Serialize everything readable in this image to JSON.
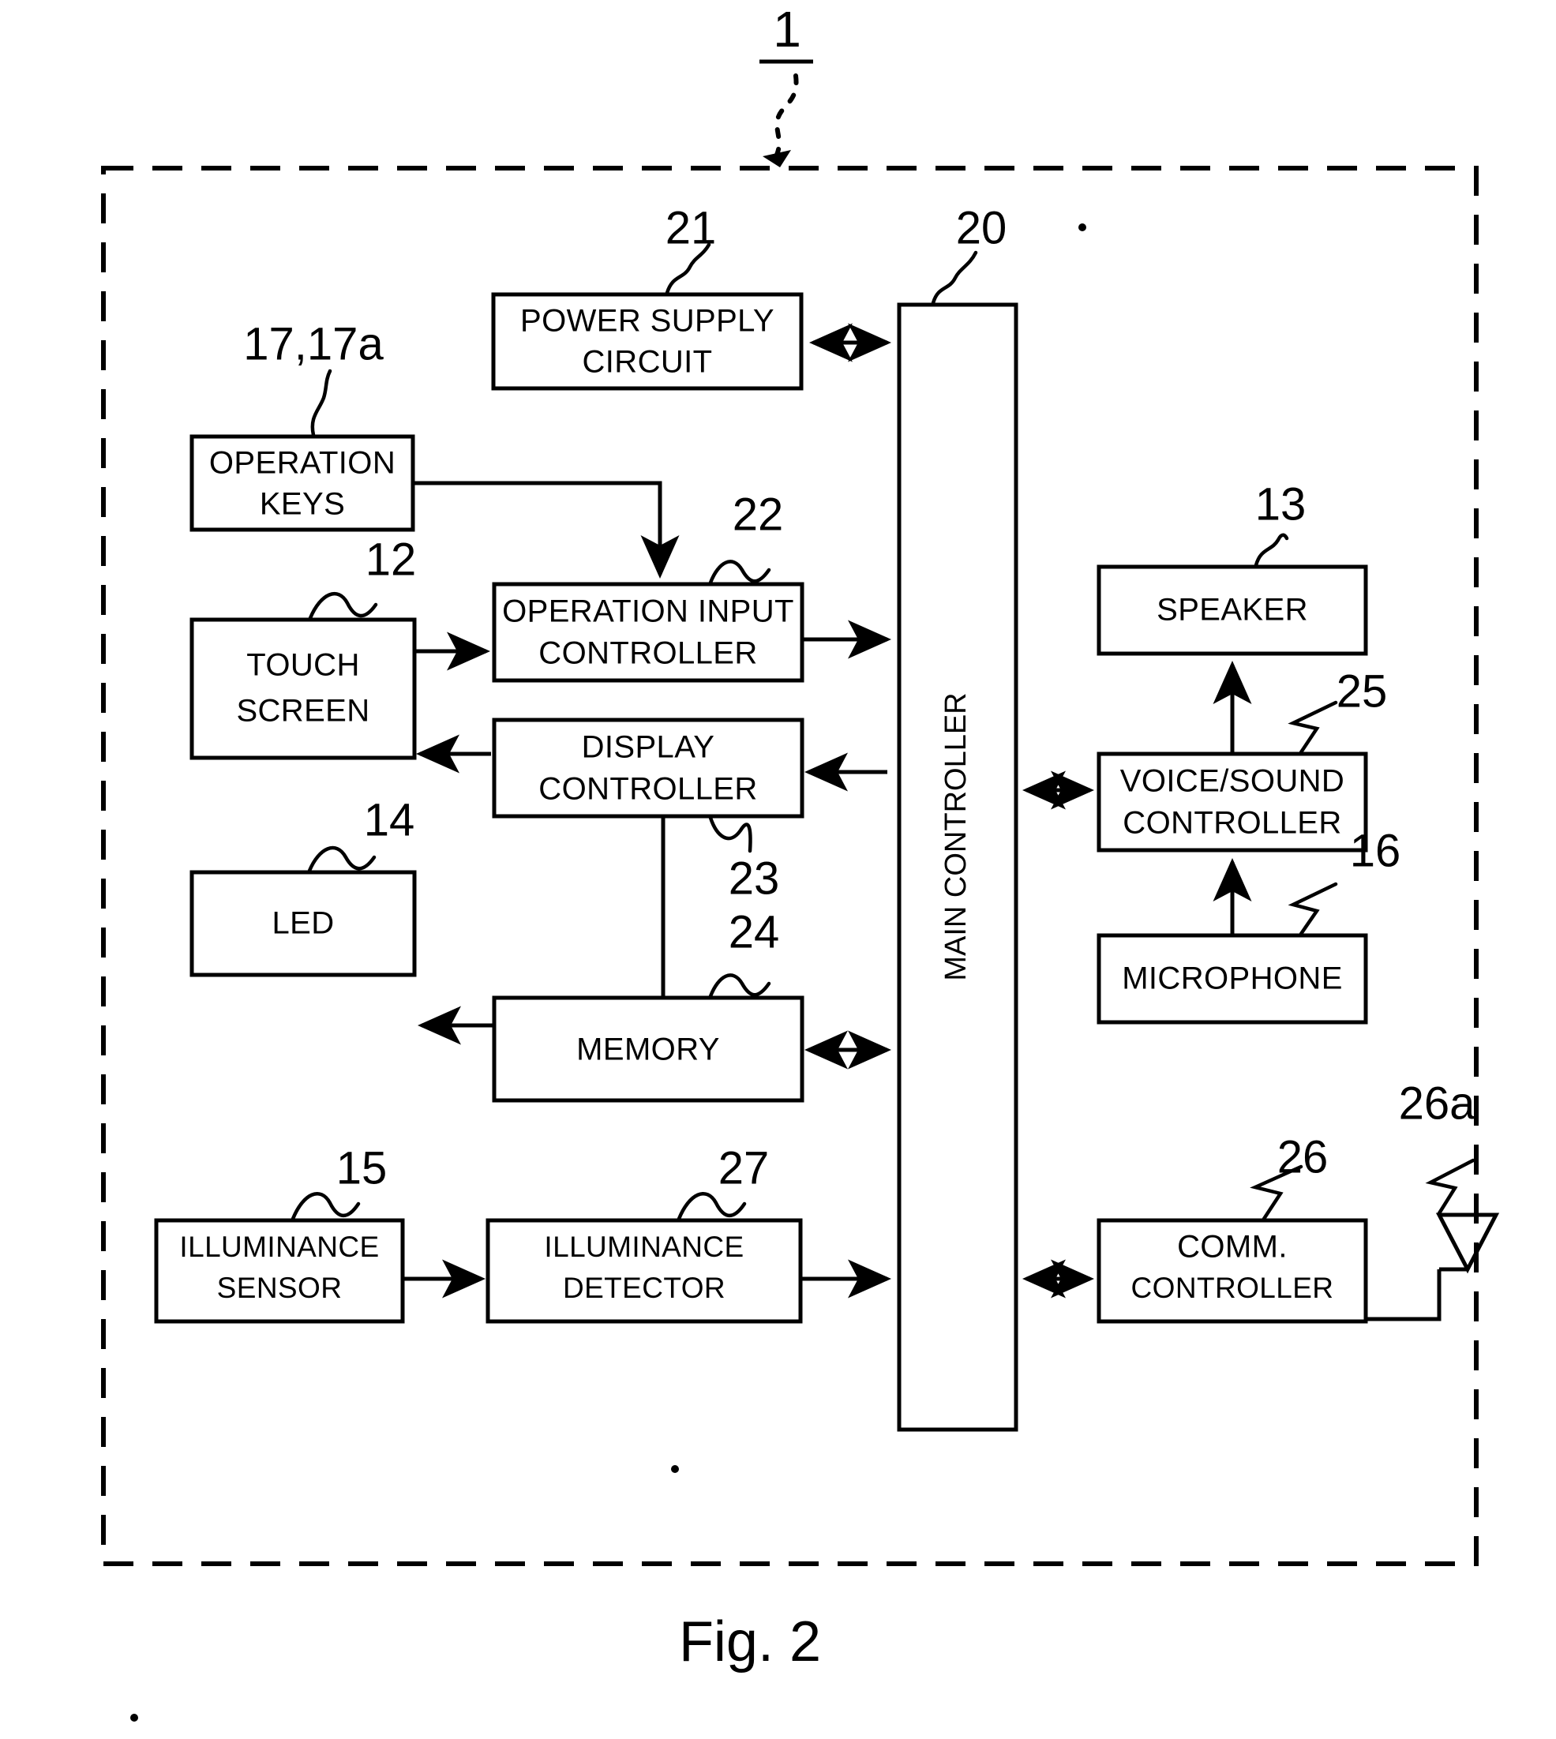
{
  "figure": {
    "caption": "Fig. 2",
    "system_ref": "1"
  },
  "blocks": {
    "power_supply": {
      "line1": "POWER SUPPLY",
      "line2": "CIRCUIT",
      "ref": "21"
    },
    "operation_keys": {
      "line1": "OPERATION",
      "line2": "KEYS",
      "ref": "17,17a"
    },
    "touch_screen": {
      "line1": "TOUCH",
      "line2": "SCREEN",
      "ref": "12"
    },
    "operation_input_controller": {
      "line1": "OPERATION INPUT",
      "line2": "CONTROLLER",
      "ref": "22"
    },
    "display_controller": {
      "line1": "DISPLAY",
      "line2": "CONTROLLER",
      "ref": "23"
    },
    "led": {
      "line1": "LED",
      "line2": "",
      "ref": "14"
    },
    "memory": {
      "line1": "MEMORY",
      "line2": "",
      "ref": "24"
    },
    "illuminance_sensor": {
      "line1": "ILLUMINANCE",
      "line2": "SENSOR",
      "ref": "15"
    },
    "illuminance_detector": {
      "line1": "ILLUMINANCE",
      "line2": "DETECTOR",
      "ref": "27"
    },
    "main_controller": {
      "line1": "MAIN CONTROLLER",
      "line2": "",
      "ref": "20"
    },
    "speaker": {
      "line1": "SPEAKER",
      "line2": "",
      "ref": "13"
    },
    "voice_sound_controller": {
      "line1": "VOICE/SOUND",
      "line2": "CONTROLLER",
      "ref": "25"
    },
    "microphone": {
      "line1": "MICROPHONE",
      "line2": "",
      "ref": "16"
    },
    "comm_controller": {
      "line1": "COMM.",
      "line2": "CONTROLLER",
      "ref": "26"
    },
    "antenna": {
      "line1": "",
      "line2": "",
      "ref": "26a"
    }
  },
  "colors": {
    "ink": "#000000",
    "paper": "#ffffff"
  }
}
